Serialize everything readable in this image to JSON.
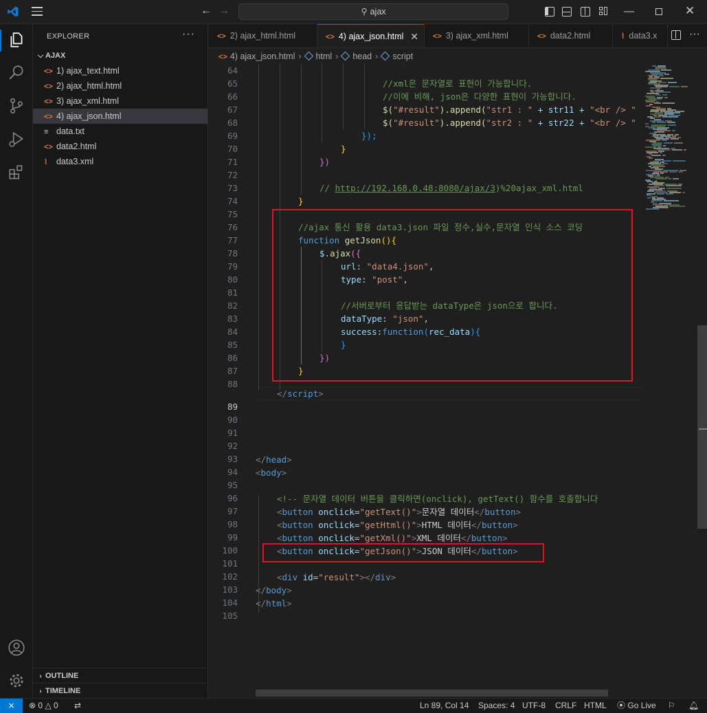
{
  "titlebar": {
    "search_text": "ajax"
  },
  "sidebar": {
    "title": "EXPLORER",
    "folder": "AJAX",
    "files": [
      {
        "name": "1) ajax_text.html",
        "type": "html"
      },
      {
        "name": "2) ajax_html.html",
        "type": "html"
      },
      {
        "name": "3) ajax_xml.html",
        "type": "html"
      },
      {
        "name": "4) ajax_json.html",
        "type": "html",
        "selected": true
      },
      {
        "name": "data.txt",
        "type": "txt"
      },
      {
        "name": "data2.html",
        "type": "html"
      },
      {
        "name": "data3.xml",
        "type": "xml"
      }
    ],
    "outline": "OUTLINE",
    "timeline": "TIMELINE"
  },
  "tabs": [
    {
      "label": "2) ajax_html.html"
    },
    {
      "label": "4) ajax_json.html",
      "active": true
    },
    {
      "label": "3) ajax_xml.html"
    },
    {
      "label": "data2.html"
    },
    {
      "label": "data3.x"
    }
  ],
  "breadcrumb": {
    "file": "4) ajax_json.html",
    "p1": "html",
    "p2": "head",
    "p3": "script"
  },
  "editor": {
    "line_numbers": [
      "64",
      "65",
      "66",
      "67",
      "68",
      "69",
      "70",
      "71",
      "72",
      "73",
      "74",
      "75",
      "76",
      "77",
      "78",
      "79",
      "80",
      "81",
      "82",
      "83",
      "84",
      "85",
      "86",
      "87",
      "88",
      "89",
      "90",
      "91",
      "92",
      "93",
      "94",
      "95",
      "96",
      "97",
      "98",
      "99",
      "100",
      "101",
      "102",
      "103",
      "104",
      "105"
    ],
    "current_line": "89",
    "code": {
      "l65": "//xml은 문자열로 표현이 가능합니다.",
      "l66": "//이에 비해, json은 다양한 표현이 가능합니다.",
      "l67_a": "$(",
      "l67_b": "\"#result\"",
      "l67_c": ").append(",
      "l67_d": "\"str1 : \"",
      "l67_e": " + str11 + ",
      "l67_f": "\"<br /> \"",
      "l68_d": "\"str2 : \"",
      "l68_e": " + str22 + ",
      "l69": "});",
      "l70": "}",
      "l71": "})",
      "l73_a": "// ",
      "l73_b": "http://192.168.0.48:8080/ajax/3",
      "l73_c": ")%20ajax_xml.html",
      "l74": "}",
      "l76": "//ajax 통신 활용 data3.json 파일 정수,실수,문자열 인식 소스 코딩",
      "l77_kw": "function",
      "l77_fn": " getJson",
      "l77_p": "(){",
      "l78_a": "$.",
      "l78_b": "ajax",
      "l78_c": "({",
      "l79_k": "url",
      "l79_s": "\"data4.json\"",
      "l80_k": "type",
      "l80_s": "\"post\"",
      "l82": "//서버로부터 응답받는 dataType은 json으로 합니다.",
      "l83_k": "dataType",
      "l83_s": "\"json\"",
      "l84_k": "success",
      "l84_kw": "function",
      "l84_p": "rec_data",
      "l85": "}",
      "l86": "})",
      "l87": "}",
      "l89_a": "</",
      "l89_b": "script",
      "l89_c": ">",
      "l94_b": "head",
      "l95_b": "body",
      "l97": "<!-- 문자열 데이터 버튼을 클릭하면(onclick), getText() 함수를 호출합니다",
      "btn": "button",
      "onclick": "onclick",
      "l98_v": "\"getText()\"",
      "l98_t": "문자열 데이터",
      "l99_v": "\"getHtml()\"",
      "l99_t": "HTML 데이터",
      "l100_v": "\"getXml()\"",
      "l100_t": "XML 데이터",
      "l101_v": "\"getJson()\"",
      "l101_t": "JSON 데이터",
      "l103_div": "div",
      "l103_id": "id",
      "l103_v": "\"result\"",
      "l105_b": "html"
    }
  },
  "statusbar": {
    "errors": "0",
    "warnings": "0",
    "position": "Ln 89, Col 14",
    "spaces": "Spaces: 4",
    "encoding": "UTF-8",
    "eol": "CRLF",
    "language": "HTML",
    "golive": "Go Live"
  },
  "colors": {
    "accent": "#0078d4",
    "highlight_box": "#e81123",
    "html_icon": "#e37933"
  }
}
